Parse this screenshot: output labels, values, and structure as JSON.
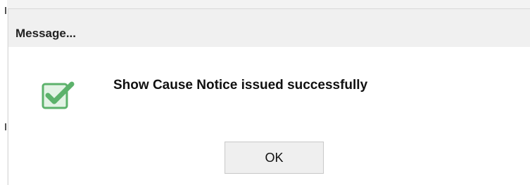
{
  "dialog": {
    "title": "Message...",
    "icon": "checkbox-checked-icon",
    "message": "Show Cause Notice issued successfully",
    "ok_label": "OK"
  },
  "colors": {
    "icon_green": "#5cb26b",
    "titlebar_bg": "#f0f0f0",
    "button_bg": "#efefef"
  }
}
